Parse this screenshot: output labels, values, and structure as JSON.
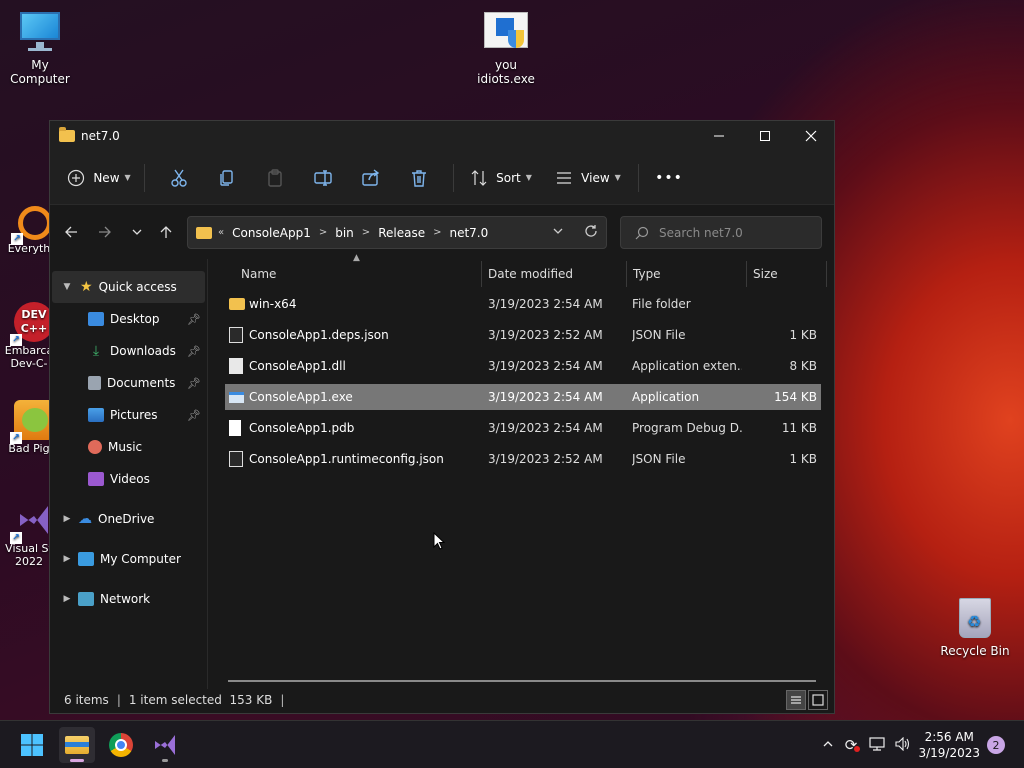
{
  "desktop": {
    "my_computer": "My Computer",
    "you_idiots": "you idiots.exe",
    "everything": "Everyth",
    "devcpp": "Embarca\nDev-C-",
    "devcpp_line1": "Embarca",
    "devcpp_line2": "Dev-C-",
    "badpiggies": "Bad Pig",
    "visualstudio_line1": "Visual St",
    "visualstudio_line2": "2022",
    "recycle_bin": "Recycle Bin"
  },
  "window": {
    "title": "net7.0",
    "toolbar": {
      "new_label": "New",
      "sort_label": "Sort",
      "view_label": "View",
      "more_label": "•••"
    },
    "breadcrumb": [
      "ConsoleApp1",
      "bin",
      "Release",
      "net7.0"
    ],
    "breadcrumb_prefix": "«",
    "search_placeholder": "Search net7.0"
  },
  "sidebar": {
    "quick_access": "Quick access",
    "items": [
      {
        "label": "Desktop",
        "pinned": true
      },
      {
        "label": "Downloads",
        "pinned": true
      },
      {
        "label": "Documents",
        "pinned": true
      },
      {
        "label": "Pictures",
        "pinned": true
      },
      {
        "label": "Music",
        "pinned": false
      },
      {
        "label": "Videos",
        "pinned": false
      }
    ],
    "onedrive": "OneDrive",
    "my_computer": "My Computer",
    "network": "Network"
  },
  "columns": {
    "name": "Name",
    "date": "Date modified",
    "type": "Type",
    "size": "Size"
  },
  "files": [
    {
      "name": "win-x64",
      "date": "3/19/2023 2:54 AM",
      "type": "File folder",
      "size": "",
      "icon": "folder-icon"
    },
    {
      "name": "ConsoleApp1.deps.json",
      "date": "3/19/2023 2:52 AM",
      "type": "JSON File",
      "size": "1 KB",
      "icon": "json-file-icon"
    },
    {
      "name": "ConsoleApp1.dll",
      "date": "3/19/2023 2:54 AM",
      "type": "Application exten...",
      "size": "8 KB",
      "icon": "dll-file-icon"
    },
    {
      "name": "ConsoleApp1.exe",
      "date": "3/19/2023 2:54 AM",
      "type": "Application",
      "size": "154 KB",
      "icon": "exe-file-icon",
      "selected": true
    },
    {
      "name": "ConsoleApp1.pdb",
      "date": "3/19/2023 2:54 AM",
      "type": "Program Debug D...",
      "size": "11 KB",
      "icon": "pdb-file-icon"
    },
    {
      "name": "ConsoleApp1.runtimeconfig.json",
      "date": "3/19/2023 2:52 AM",
      "type": "JSON File",
      "size": "1 KB",
      "icon": "json-file-icon"
    }
  ],
  "status": {
    "items": "6 items",
    "selected": "1 item selected  153 KB"
  },
  "taskbar": {
    "time": "2:56 AM",
    "date": "3/19/2023",
    "notifications": "2"
  },
  "colors": {
    "accent": "#7fb6ee",
    "folder": "#f2c14e",
    "selection": "#777777"
  }
}
